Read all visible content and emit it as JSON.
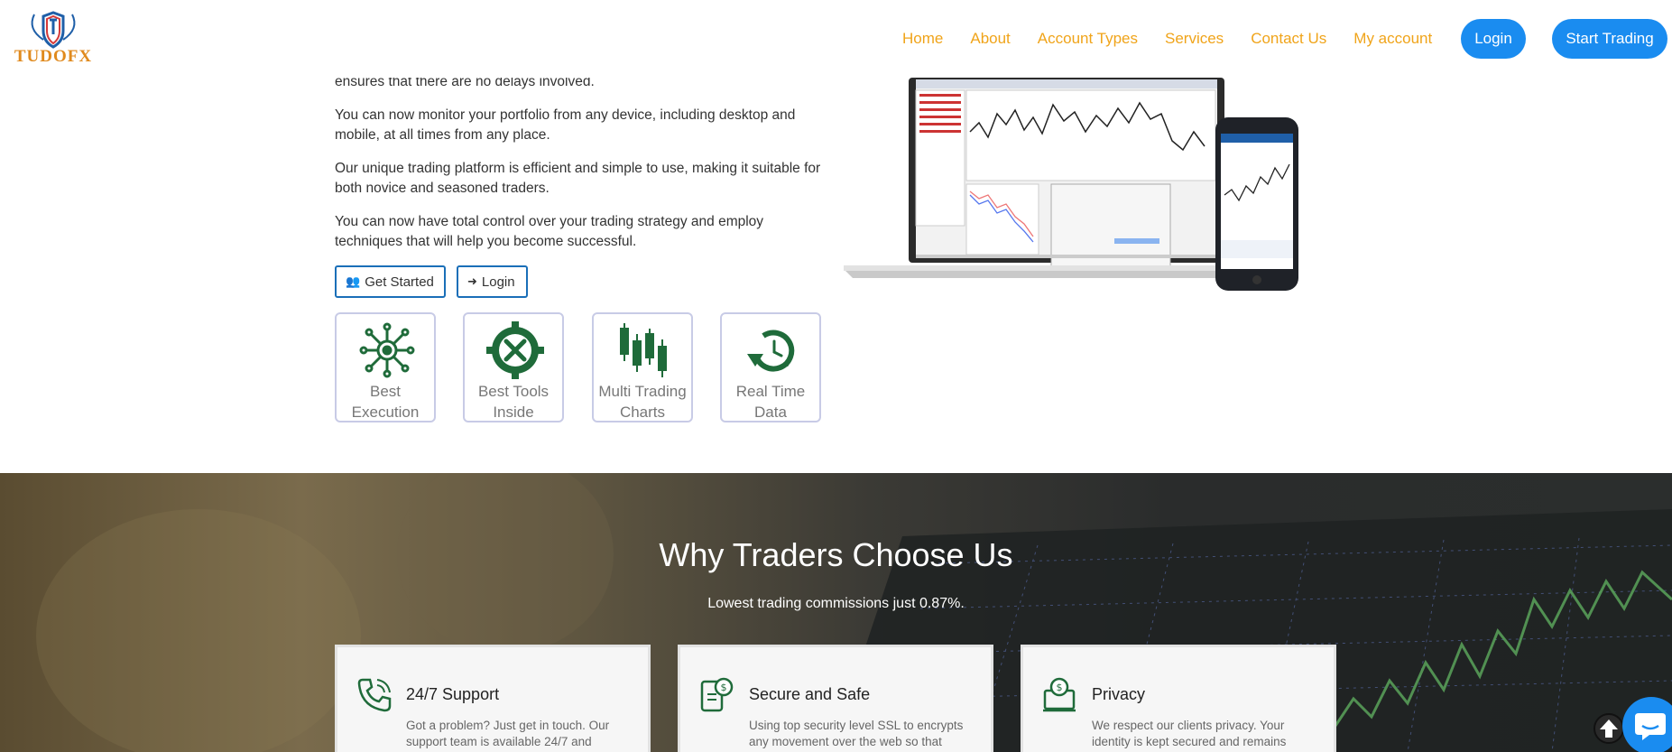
{
  "brand": {
    "logo_text": "TUDOFX"
  },
  "nav": {
    "items": [
      "Home",
      "About",
      "Account Types",
      "Services",
      "Contact Us",
      "My account"
    ],
    "login_label": "Login",
    "start_label": "Start Trading"
  },
  "hero": {
    "p0": "ensures that there are no delays involved.",
    "p1": "You can now monitor your portfolio from any device, including desktop and mobile, at all times from any place.",
    "p2": "Our unique trading platform is efficient and simple to use, making it suitable for both novice and seasoned traders.",
    "p3": "You can now have total control over your trading strategy and employ techniques that will help you become successful.",
    "get_started_label": "Get Started",
    "login_label": "Login"
  },
  "features": [
    {
      "label": "Best Execution",
      "icon": "network-gear-icon"
    },
    {
      "label": "Best Tools Inside",
      "icon": "tools-gear-icon"
    },
    {
      "label": "Multi Trading Charts",
      "icon": "candlestick-icon"
    },
    {
      "label": "Real Time Data",
      "icon": "clock-arrow-icon"
    }
  ],
  "why": {
    "title": "Why Traders Choose Us",
    "subtitle": "Lowest trading commissions just 0.87%.",
    "cards": [
      {
        "title": "24/7 Support",
        "text": "Got a problem? Just get in touch. Our support team is available 24/7 and",
        "icon": "phone-icon"
      },
      {
        "title": "Secure and Safe",
        "text": "Using top security level SSL to encrypts any movement over the web so that",
        "icon": "secure-device-icon"
      },
      {
        "title": "Privacy",
        "text": "We respect our clients privacy. Your identity is kept secured and remains",
        "icon": "privacy-icon"
      }
    ]
  },
  "colors": {
    "nav": "#f0a41a",
    "accent": "#1a8cf0",
    "icon_green": "#1f6b3a"
  }
}
